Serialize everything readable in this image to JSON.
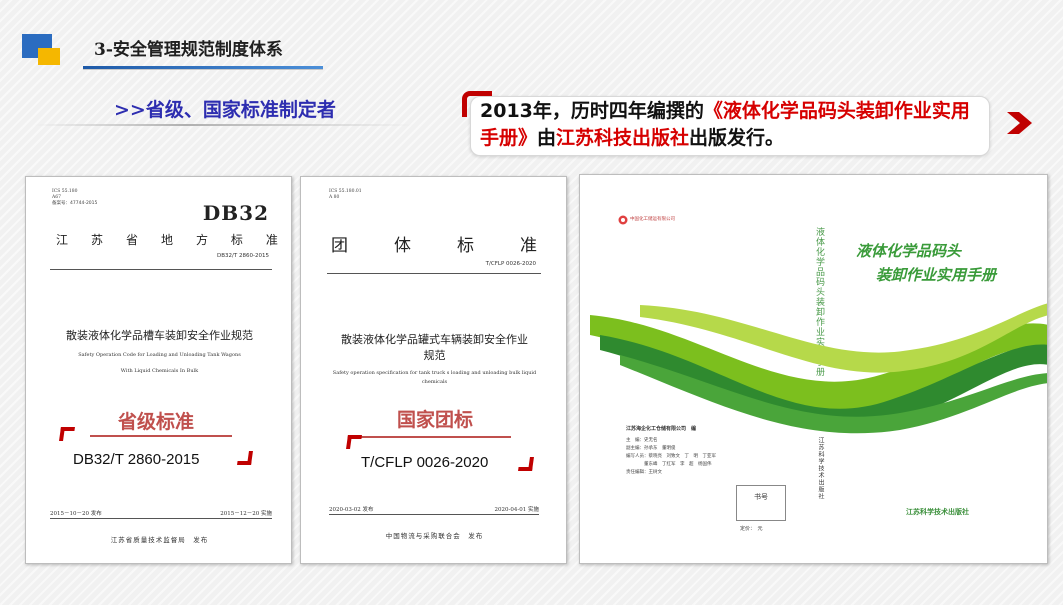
{
  "header": {
    "title": "3-安全管理规范制度体系",
    "subtitle": ">>省级、国家标准制定者"
  },
  "callout": {
    "part1": "2013年，历时四年编撰的",
    "book_name": "《液体化学品码头装卸作业实用手册》",
    "part2": "由",
    "publisher": "江苏科技出版社",
    "part3": "出版发行。"
  },
  "doc1": {
    "ics": "ICS 55.180",
    "ccs": "A67",
    "record": "备案号：47744-2015",
    "code_big": "DB32",
    "header_chars": [
      "江",
      "苏",
      "省",
      "地",
      "方",
      "标",
      "准"
    ],
    "code": "DB32/T 2860-2015",
    "title": "散装液体化学品槽车装卸安全作业规范",
    "title_en_1": "Safety Operation Code for Loading and Unloading Tank Wagons",
    "title_en_2": "With Liquid Chemicals In Bulk",
    "release_date": "2015－10－20 发布",
    "impl_date": "2015－12－20 实施",
    "issuer": "江苏省质量技术监督局　发布",
    "tag_label": "省级标准",
    "tag_code": "DB32/T 2860-2015"
  },
  "doc2": {
    "ics": "ICS 55.180.01",
    "ccs": "A 80",
    "header_chars": [
      "团",
      "体",
      "标",
      "准"
    ],
    "code": "T/CFLP 0026-2020",
    "title_1": "散装液体化学品罐式车辆装卸安全作业",
    "title_2": "规范",
    "title_en_1": "Safety operation specification for tank truck s loading and unloading bulk liquid",
    "title_en_2": "chemicals",
    "release_date": "2020-03-02 发布",
    "impl_date": "2020-04-01 实施",
    "issuer": "中国物流与采购联合会　发布",
    "tag_label": "国家团标",
    "tag_code": "T/CFLP 0026-2020"
  },
  "book": {
    "company": "中国化工储运有限公司",
    "title_1": "液体化学品码头",
    "title_2": "装卸作业实用手册",
    "spine_title": "液体化学品码头装卸作业实用手册",
    "editor": "江苏海企化工仓储有限公司　编",
    "spine_publisher": "江苏科学技术出版社",
    "stamp": "书号",
    "price": "定价：　元",
    "publisher": "江苏科学技术出版社",
    "meta": [
      "主　编：史无名",
      "副主编：孙承东　董明俊",
      "编写人员：蔡晓亮　刘致文　丁　明　丁亚军",
      "　　　　董东峰　丁红军　李　超　杨国伟",
      "责任编辑：王树文"
    ]
  },
  "colors": {
    "accent_red": "#c00000",
    "title_blue": "#2d2db0",
    "tag_red": "#c0504d",
    "book_green": "#3a9b3a"
  }
}
